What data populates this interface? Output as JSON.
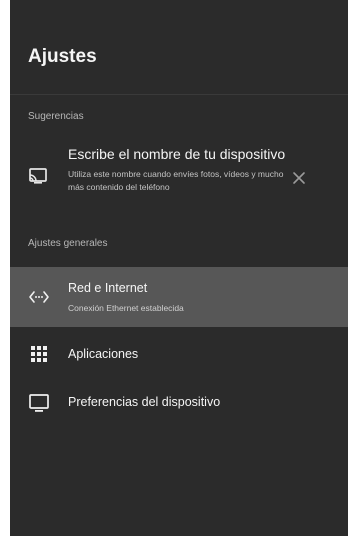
{
  "header": {
    "title": "Ajustes"
  },
  "sections": {
    "suggestions_label": "Sugerencias",
    "general_label": "Ajustes generales"
  },
  "suggestion": {
    "title": "Escribe el nombre de tu dispositivo",
    "description": "Utiliza este nombre cuando envíes fotos, vídeos y mucho más contenido del teléfono",
    "icon": "cast-icon",
    "dismiss_icon": "close-icon"
  },
  "items": [
    {
      "label": "Red e Internet",
      "sub": "Conexión Ethernet establecida",
      "icon": "ethernet-icon",
      "selected": true
    },
    {
      "label": "Aplicaciones",
      "icon": "apps-grid-icon"
    },
    {
      "label": "Preferencias del dispositivo",
      "icon": "tv-icon"
    }
  ],
  "colors": {
    "panel_bg": "#2b2b2b",
    "selected_bg": "#575757",
    "text_primary": "#f5f5f5",
    "text_secondary": "#b7b7b7"
  }
}
